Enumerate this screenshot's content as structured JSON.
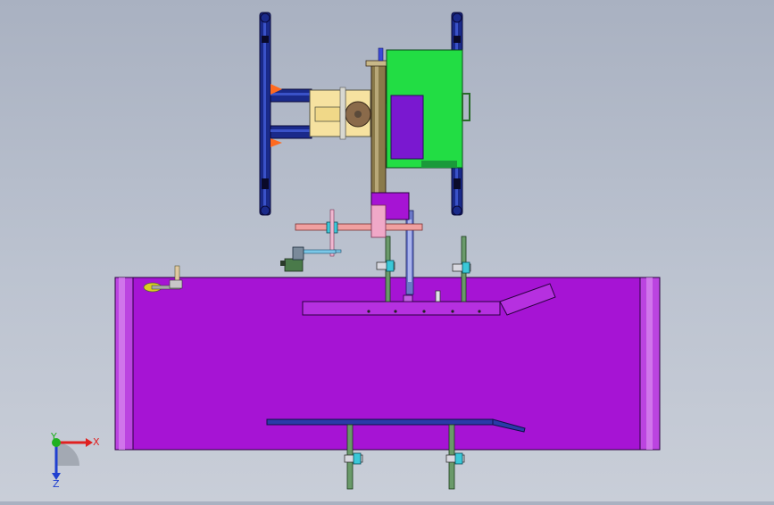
{
  "viewport": {
    "background_top": "#a9b1c1",
    "background_bottom": "#c9ced8"
  },
  "colors": {
    "base_body": "#a814d6",
    "base_edge": "#c860e8",
    "frame_blue": "#1a2a8a",
    "motor_green": "#22dd44",
    "motor_purple": "#7a18d0",
    "bracket_yellow": "#f6e2a0",
    "column_olive": "#8a7a4a",
    "rod_pink": "#f0a0a0",
    "orange_accent": "#ff6a20",
    "green_post": "#5a8a5a",
    "cyan_clamp": "#3ac8d8"
  },
  "triad": {
    "x_label": "X",
    "y_label": "Y",
    "z_label": "Z",
    "x_color": "#e02020",
    "y_color": "#20b020",
    "z_color": "#2040d0"
  }
}
